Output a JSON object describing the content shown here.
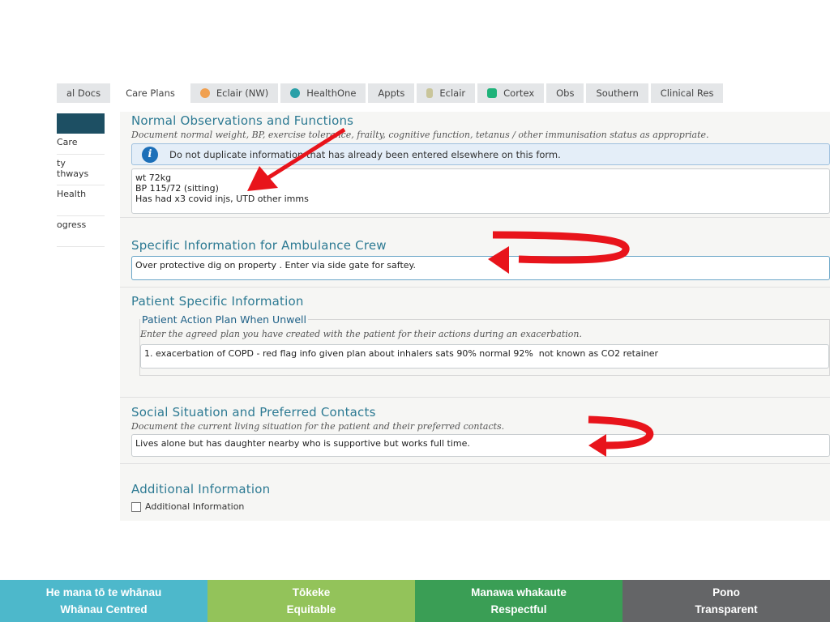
{
  "tabs": [
    {
      "label": "al Docs"
    },
    {
      "label": "Care Plans",
      "active": true
    },
    {
      "label": "Eclair (NW)",
      "icon": "eclair-icon"
    },
    {
      "label": "HealthOne",
      "icon": "healthone-icon"
    },
    {
      "label": "Appts"
    },
    {
      "label": "Eclair",
      "icon": "eclair-icon"
    },
    {
      "label": "Cortex",
      "icon": "cortex-icon"
    },
    {
      "label": "Obs"
    },
    {
      "label": "Southern"
    },
    {
      "label": "Clinical Res"
    }
  ],
  "sidebar": {
    "items": [
      "Care",
      "ty\nthways",
      "Health",
      "ogress"
    ]
  },
  "normal_obs": {
    "title": "Normal Observations and Functions",
    "subtitle": "Document normal weight, BP, exercise tolerance, frailty, cognitive function, tetanus / other immunisation status as appropriate.",
    "info": "Do not duplicate information that has already been entered elsewhere on this form.",
    "value": "wt 72kg\nBP 115/72 (sitting)\nHas had x3 covid injs, UTD other imms"
  },
  "ambulance": {
    "title": "Specific Information for Ambulance Crew",
    "value": "Over protective dig on property . Enter via side gate for saftey."
  },
  "patient": {
    "title": "Patient Specific Information",
    "legend": "Patient Action Plan When Unwell",
    "subtitle": "Enter the agreed plan you have created with the patient for their actions during an exacerbation.",
    "value": "1. exacerbation of COPD - red flag info given plan about inhalers sats 90% normal 92%  not known as CO2 retainer"
  },
  "social": {
    "title": "Social Situation and Preferred Contacts",
    "subtitle": "Document the current living situation for the patient and their preferred contacts.",
    "value": "Lives alone but has daughter nearby who is supportive but works full time."
  },
  "additional": {
    "title": "Additional Information",
    "checkbox_label": "Additional Information",
    "checked": false
  },
  "footer": [
    {
      "line1": "He mana tō te whānau",
      "line2": "Whānau Centred",
      "color": "#4db8cb"
    },
    {
      "line1": "Tōkeke",
      "line2": "Equitable",
      "color": "#93c35a"
    },
    {
      "line1": "Manawa whakaute",
      "line2": "Respectful",
      "color": "#3a9e55"
    },
    {
      "line1": "Pono",
      "line2": "Transparent",
      "color": "#646567"
    }
  ],
  "annotation_color": "#e8141b"
}
